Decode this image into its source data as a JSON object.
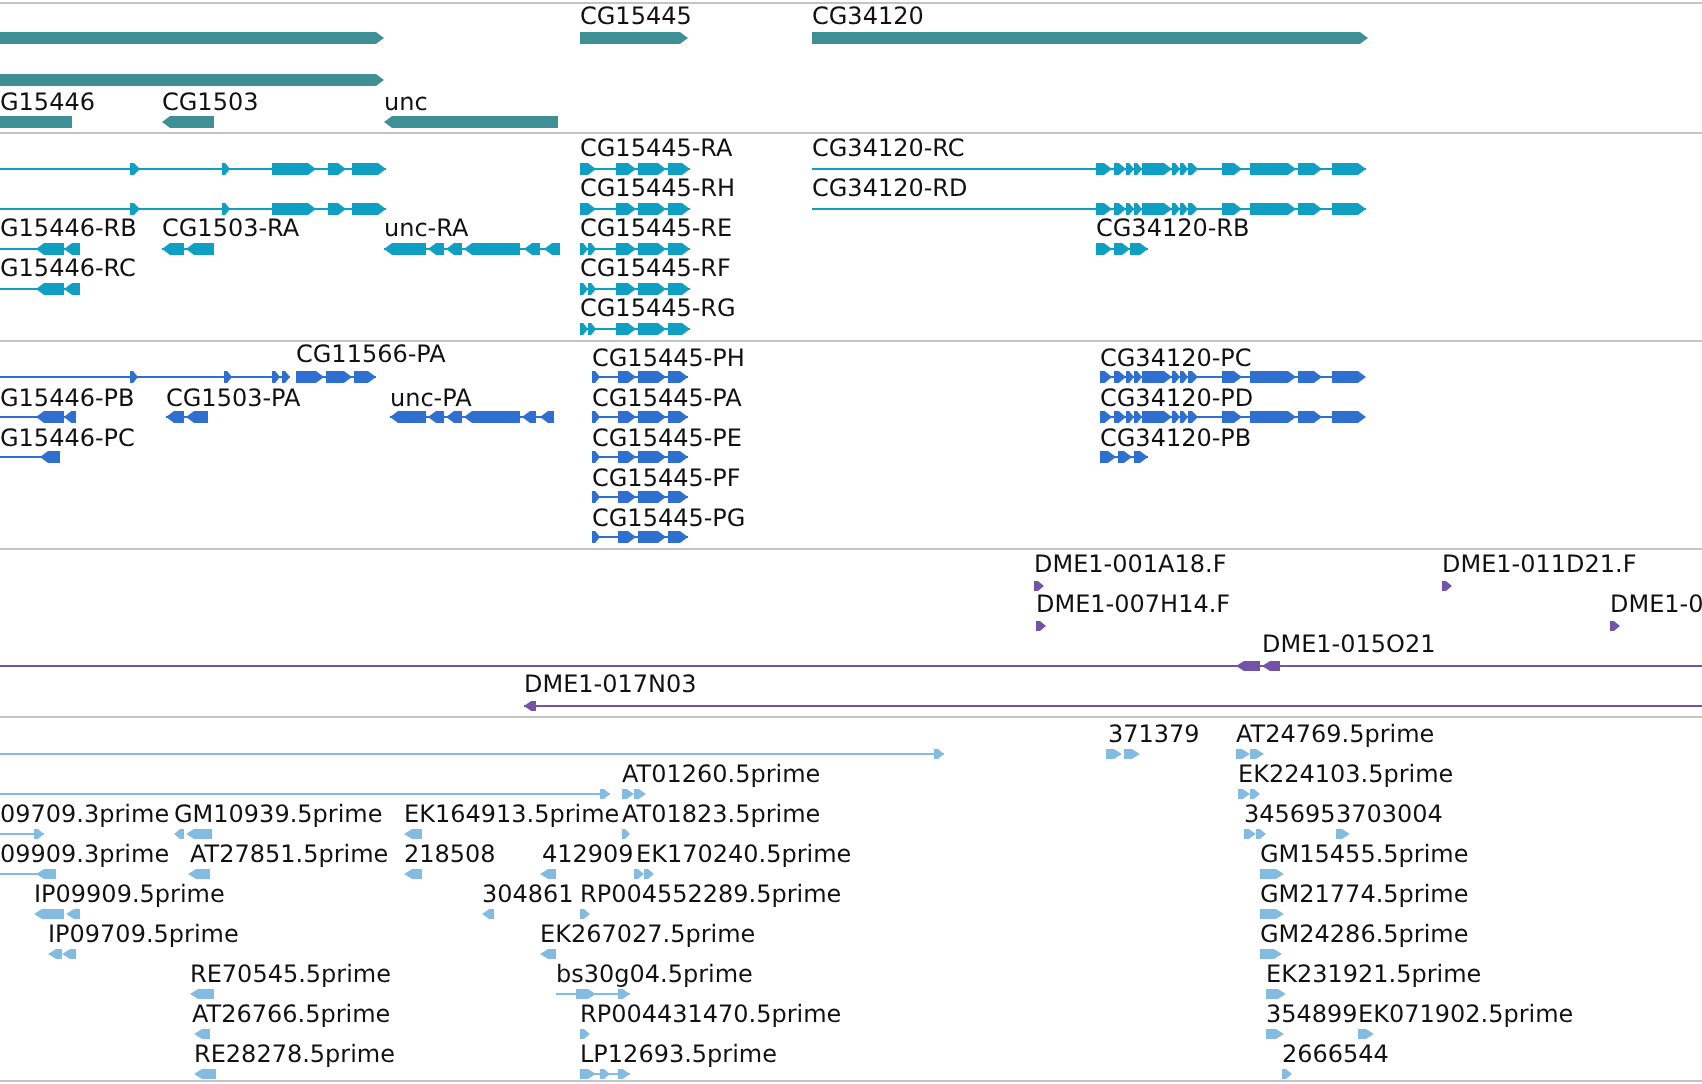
{
  "tracks": [
    {
      "kind": "gene",
      "features": [
        {
          "kind": "bar",
          "reverse": false
        },
        {
          "kind": "bar",
          "reverse": false
        },
        {
          "kind": "bar",
          "reverse": true,
          "label": "G15446"
        },
        {
          "kind": "bar",
          "reverse": true,
          "label": "CG1503"
        },
        {
          "kind": "bar",
          "reverse": true,
          "label": "unc"
        },
        {
          "kind": "bar",
          "reverse": false,
          "label": "CG15445"
        },
        {
          "kind": "bar",
          "reverse": false,
          "label": "CG34120"
        }
      ]
    },
    {
      "kind": "mrna",
      "features": [
        {
          "kind": "transcript",
          "reverse": false
        },
        {
          "kind": "transcript",
          "reverse": false
        },
        {
          "kind": "transcript",
          "reverse": true,
          "label": "G15446-RB"
        },
        {
          "kind": "transcript",
          "reverse": true,
          "label": "G15446-RC"
        },
        {
          "kind": "transcript",
          "reverse": true,
          "label": "CG1503-RA"
        },
        {
          "kind": "transcript",
          "reverse": true,
          "label": "unc-RA"
        },
        {
          "kind": "transcript",
          "reverse": false,
          "label": "CG15445-RA"
        },
        {
          "kind": "transcript",
          "reverse": false,
          "label": "CG15445-RH"
        },
        {
          "kind": "transcript",
          "reverse": false,
          "label": "CG15445-RE"
        },
        {
          "kind": "transcript",
          "reverse": false,
          "label": "CG15445-RF"
        },
        {
          "kind": "transcript",
          "reverse": false,
          "label": "CG15445-RG"
        },
        {
          "kind": "transcript",
          "reverse": false,
          "label": "CG34120-RC"
        },
        {
          "kind": "transcript",
          "reverse": false,
          "label": "CG34120-RD"
        },
        {
          "kind": "transcript",
          "reverse": false,
          "label": "CG34120-RB"
        }
      ]
    },
    {
      "kind": "protein",
      "features": [
        {
          "kind": "transcript",
          "reverse": false
        },
        {
          "kind": "transcript",
          "reverse": false,
          "label": "CG11566-PA"
        },
        {
          "kind": "transcript",
          "reverse": true,
          "label": "G15446-PB"
        },
        {
          "kind": "transcript",
          "reverse": true,
          "label": "G15446-PC"
        },
        {
          "kind": "transcript",
          "reverse": true,
          "label": "CG1503-PA"
        },
        {
          "kind": "transcript",
          "reverse": true,
          "label": "unc-PA"
        },
        {
          "kind": "transcript",
          "reverse": false,
          "label": "CG15445-PH"
        },
        {
          "kind": "transcript",
          "reverse": false,
          "label": "CG15445-PA"
        },
        {
          "kind": "transcript",
          "reverse": false,
          "label": "CG15445-PE"
        },
        {
          "kind": "transcript",
          "reverse": false,
          "label": "CG15445-PF"
        },
        {
          "kind": "transcript",
          "reverse": false,
          "label": "CG15445-PG"
        },
        {
          "kind": "transcript",
          "reverse": false,
          "label": "CG34120-PC"
        },
        {
          "kind": "transcript",
          "reverse": false,
          "label": "CG34120-PD"
        },
        {
          "kind": "transcript",
          "reverse": false,
          "label": "CG34120-PB"
        }
      ]
    },
    {
      "kind": "clone",
      "features": [
        {
          "kind": "read",
          "reverse": false,
          "label": "DME1-001A18.F"
        },
        {
          "kind": "read",
          "reverse": false,
          "label": "DME1-011D21.F"
        },
        {
          "kind": "read",
          "reverse": false,
          "label": "DME1-007H14.F"
        },
        {
          "kind": "read",
          "reverse": false,
          "label": "DME1-0"
        },
        {
          "kind": "transcript",
          "reverse": true,
          "label": "DME1-015O21"
        },
        {
          "kind": "transcript",
          "reverse": true,
          "label": "DME1-017N03"
        }
      ]
    },
    {
      "kind": "est",
      "features": [
        {
          "kind": "transcript",
          "reverse": false
        },
        {
          "kind": "read",
          "reverse": false,
          "label": "371379"
        },
        {
          "kind": "read",
          "reverse": false,
          "label": "AT24769.5prime"
        },
        {
          "kind": "transcript",
          "reverse": false
        },
        {
          "kind": "read",
          "reverse": false,
          "label": "AT01260.5prime"
        },
        {
          "kind": "read",
          "reverse": false,
          "label": "EK224103.5prime"
        },
        {
          "kind": "transcript",
          "reverse": false,
          "label": "09709.3prime"
        },
        {
          "kind": "read",
          "reverse": true,
          "label": "GM10939.5prime"
        },
        {
          "kind": "read",
          "reverse": true,
          "label": "EK164913.5prime"
        },
        {
          "kind": "read",
          "reverse": false,
          "label": "AT01823.5prime"
        },
        {
          "kind": "read",
          "reverse": false,
          "label": "345695"
        },
        {
          "kind": "read",
          "reverse": false,
          "label": "3703004"
        },
        {
          "kind": "transcript",
          "reverse": true,
          "label": "09909.3prime"
        },
        {
          "kind": "read",
          "reverse": true,
          "label": "AT27851.5prime"
        },
        {
          "kind": "read",
          "reverse": true,
          "label": "218508"
        },
        {
          "kind": "read",
          "reverse": true,
          "label": "412909"
        },
        {
          "kind": "read",
          "reverse": false,
          "label": "EK170240.5prime"
        },
        {
          "kind": "read",
          "reverse": false,
          "label": "GM15455.5prime"
        },
        {
          "kind": "read",
          "reverse": true,
          "label": "IP09909.5prime"
        },
        {
          "kind": "read",
          "reverse": true,
          "label": "304861"
        },
        {
          "kind": "read",
          "reverse": false,
          "label": "RP004552289.5prime"
        },
        {
          "kind": "read",
          "reverse": false,
          "label": "GM21774.5prime"
        },
        {
          "kind": "read",
          "reverse": true,
          "label": "IP09709.5prime"
        },
        {
          "kind": "read",
          "reverse": true,
          "label": "EK267027.5prime"
        },
        {
          "kind": "read",
          "reverse": false,
          "label": "GM24286.5prime"
        },
        {
          "kind": "read",
          "reverse": true,
          "label": "RE70545.5prime"
        },
        {
          "kind": "transcript",
          "reverse": false,
          "label": "bs30g04.5prime"
        },
        {
          "kind": "read",
          "reverse": false,
          "label": "EK231921.5prime"
        },
        {
          "kind": "read",
          "reverse": true,
          "label": "AT26766.5prime"
        },
        {
          "kind": "read",
          "reverse": false,
          "label": "RP004431470.5prime"
        },
        {
          "kind": "read",
          "reverse": false,
          "label": "354899"
        },
        {
          "kind": "read",
          "reverse": false,
          "label": "EK071902.5prime"
        },
        {
          "kind": "read",
          "reverse": true,
          "label": "RE28278.5prime"
        },
        {
          "kind": "transcript",
          "reverse": false,
          "label": "LP12693.5prime"
        },
        {
          "kind": "read",
          "reverse": false,
          "label": "2666544"
        }
      ]
    }
  ]
}
